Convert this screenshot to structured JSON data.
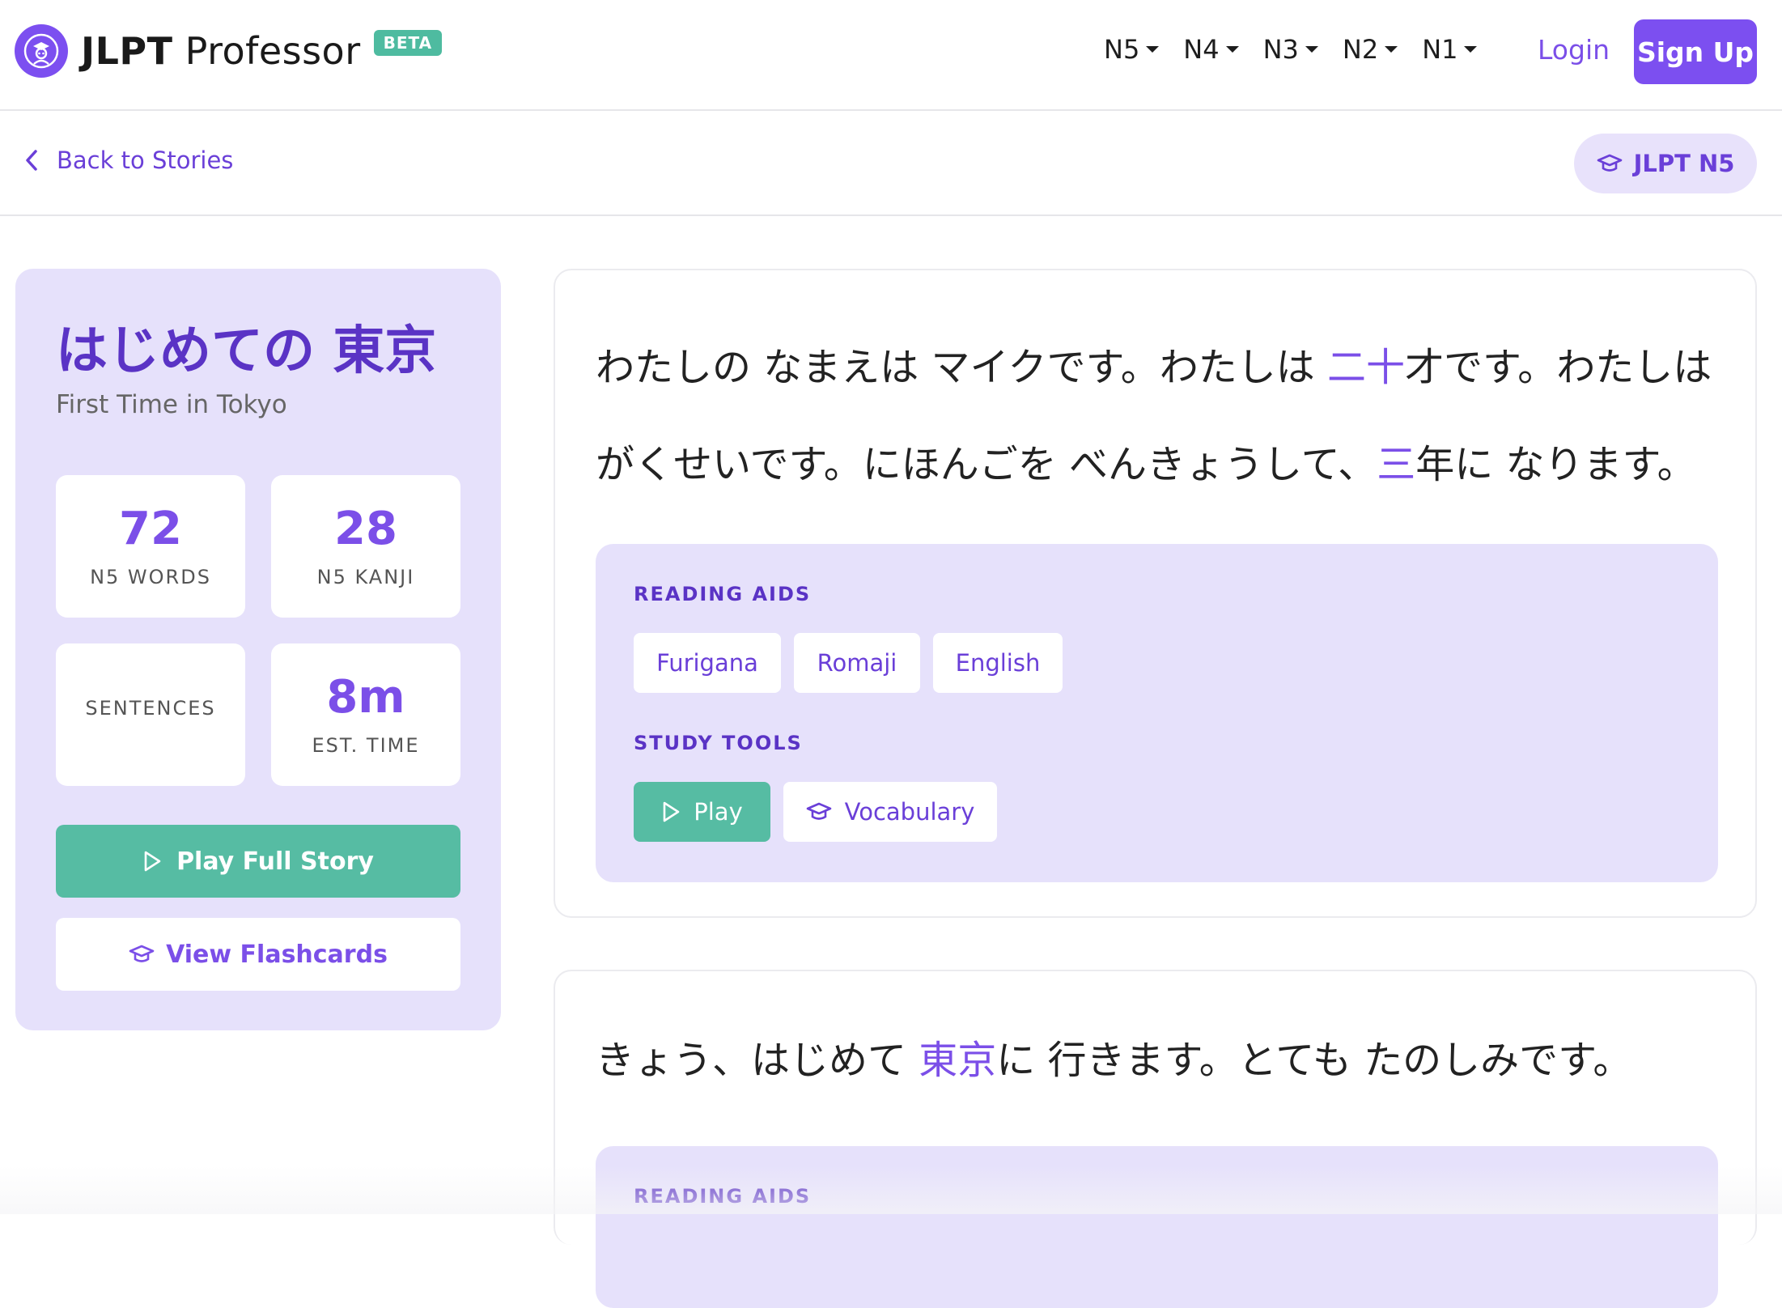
{
  "brand": {
    "name_bold": "JLPT",
    "name_light": "Professor",
    "badge": "BETA"
  },
  "nav": {
    "levels": [
      "N5",
      "N4",
      "N3",
      "N2",
      "N1"
    ],
    "login_label": "Login",
    "signup_label": "Sign Up"
  },
  "subbar": {
    "back_label": "Back to Stories",
    "level_label": "JLPT N5"
  },
  "story": {
    "title": "はじめての 東京",
    "subtitle": "First Time in Tokyo",
    "stats": [
      {
        "value": "72",
        "label": "N5 WORDS"
      },
      {
        "value": "28",
        "label": "N5 KANJI"
      },
      {
        "value": "",
        "label": "SENTENCES"
      },
      {
        "value": "8m",
        "label": "EST. TIME"
      }
    ],
    "play_full_label": "Play Full Story",
    "flashcards_label": "View Flashcards"
  },
  "sentences": [
    {
      "line1": {
        "a": "わたしの なまえは マイクです。わたしは ",
        "hl": "二十",
        "b": "才です。わたしは"
      },
      "line2": {
        "a": "がくせいです。にほんごを べんきょうして、",
        "hl": "三",
        "b": "年に なります。"
      },
      "aids_label": "READING AIDS",
      "aids": [
        "Furigana",
        "Romaji",
        "English"
      ],
      "tools_label": "STUDY TOOLS",
      "play_label": "Play",
      "vocab_label": "Vocabulary"
    },
    {
      "line1": {
        "a": "きょう、はじめて ",
        "hl": "東京",
        "b": "に 行きます。とても たのしみです。"
      },
      "aids_label": "READING AIDS"
    }
  ],
  "colors": {
    "accent": "#7c4ff0",
    "teal": "#56bca3",
    "panel": "#e6e1fb",
    "beta": "#4ebba0"
  },
  "icons": [
    "professor-avatar-icon",
    "chevron-left-icon",
    "graduation-cap-icon",
    "play-icon",
    "caret-down-icon"
  ]
}
